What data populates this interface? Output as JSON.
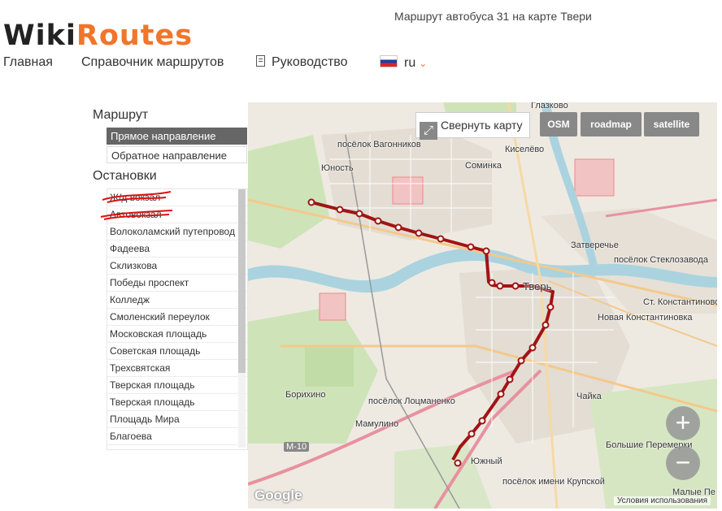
{
  "logo": {
    "part1": "Wiki",
    "part2": "Routes"
  },
  "page_title": "Маршрут автобуса 31 на карте Твери",
  "nav": {
    "home": "Главная",
    "directory": "Справочник маршрутов",
    "guide": "Руководство",
    "lang": "ru"
  },
  "route": {
    "heading": "Маршрут",
    "directions": [
      "Прямое направление",
      "Обратное направление"
    ],
    "active_direction": "Прямое направление"
  },
  "stops": {
    "heading": "Остановки",
    "items": [
      "Ж/д вокзал",
      "Автовокзал",
      "Волоколамский путепровод",
      "Фадеева",
      "Склизкова",
      "Победы проспект",
      "Колледж",
      "Смоленский переулок",
      "Московская площадь",
      "Советская площадь",
      "Трехсвятская",
      "Тверская площадь",
      "Тверская площадь",
      "Площадь Мира",
      "Благоева"
    ]
  },
  "map": {
    "collapse_label": "Свернуть карту",
    "types": [
      "OSM",
      "roadmap",
      "satellite"
    ],
    "zoom_in": "+",
    "zoom_out": "−",
    "attribution": "Google",
    "terms": "Условия использования",
    "route_color": "#a01414",
    "labels": {
      "glazkovo": "Глазково",
      "vagonnikov": "посёлок Вагонников",
      "kiselevo": "Киселёво",
      "yunost": "Юность",
      "sominka": "Соминка",
      "zatverechye": "Затверечье",
      "steklozavoda": "посёлок Стеклозавода",
      "tver": "Тверь",
      "st_konstantinovo": "Ст. Константиново",
      "nova_konstantinovka": "Новая Константиновка",
      "borikhino": "Борихино",
      "lotsmanenko": "посёлок Лоцманенко",
      "chayka": "Чайка",
      "mamulino": "Мамулино",
      "bolshie_peremerki": "Большие Перемерки",
      "m10": "M-10",
      "yuzhny": "Южный",
      "krupskoy": "посёлок имени Крупской",
      "malye_pere": "Малые Пе"
    }
  }
}
